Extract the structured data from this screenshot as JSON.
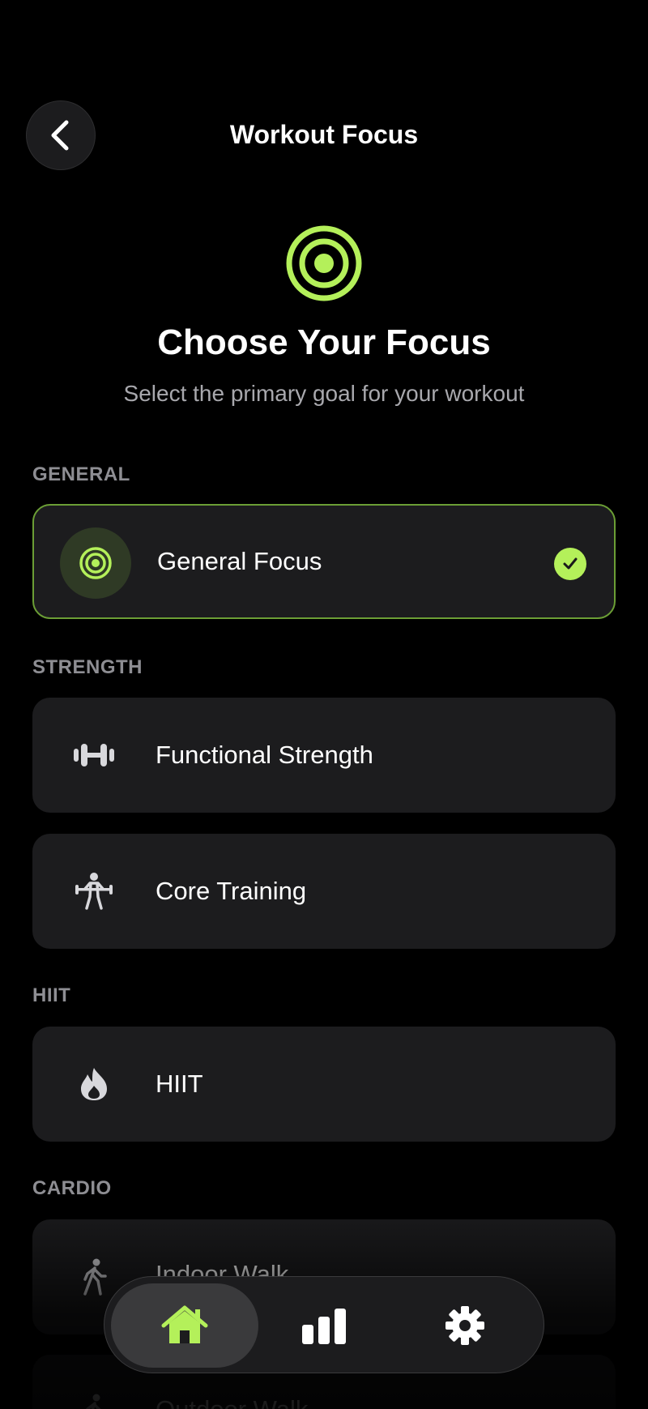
{
  "header": {
    "title": "Workout Focus"
  },
  "hero": {
    "title": "Choose Your Focus",
    "subtitle": "Select the primary goal for your workout"
  },
  "sections": [
    {
      "label": "GENERAL",
      "items": [
        {
          "label": "General Focus",
          "icon": "target-icon",
          "selected": true
        }
      ]
    },
    {
      "label": "STRENGTH",
      "items": [
        {
          "label": "Functional Strength",
          "icon": "dumbbell-icon",
          "selected": false
        },
        {
          "label": "Core Training",
          "icon": "weightlifter-icon",
          "selected": false
        }
      ]
    },
    {
      "label": "HIIT",
      "items": [
        {
          "label": "HIIT",
          "icon": "flame-icon",
          "selected": false
        }
      ]
    },
    {
      "label": "CARDIO",
      "items": [
        {
          "label": "Indoor Walk",
          "icon": "walking-icon",
          "selected": false
        },
        {
          "label": "Outdoor Walk",
          "icon": "walking-icon",
          "selected": false
        }
      ]
    }
  ],
  "tabbar": {
    "tabs": [
      {
        "name": "home",
        "icon": "home-icon",
        "active": true
      },
      {
        "name": "stats",
        "icon": "bar-chart-icon",
        "active": false
      },
      {
        "name": "settings",
        "icon": "gear-icon",
        "active": false
      }
    ]
  },
  "colors": {
    "accent": "#b4f05a",
    "selected_border": "#6b9e35",
    "card_bg": "#1c1c1e",
    "muted_text": "#8e8e93"
  }
}
